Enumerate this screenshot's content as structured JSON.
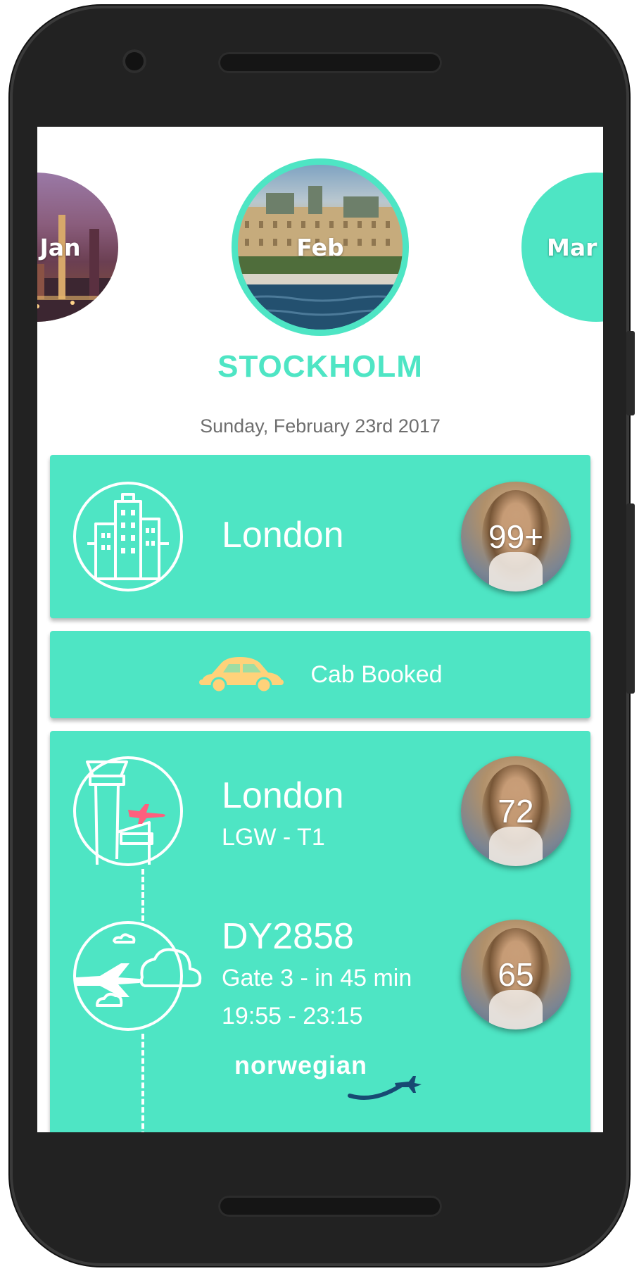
{
  "months": {
    "prev": "Jan",
    "current": "Feb",
    "next": "Mar"
  },
  "destination": {
    "city": "STOCKHOLM",
    "date": "Sunday, February 23rd 2017"
  },
  "cards": {
    "origin": {
      "city": "London",
      "count": "99+"
    },
    "cab": {
      "label": "Cab Booked"
    },
    "airport": {
      "city": "London",
      "terminal": "LGW - T1",
      "count": "72"
    },
    "flight": {
      "number": "DY2858",
      "gate": "Gate 3 - in 45 min",
      "time": "19:55 - 23:15",
      "airline": "norwegian",
      "count": "65"
    }
  },
  "colors": {
    "accent": "#4ee5c4",
    "text_light": "#ffffff",
    "date_text": "#6e6e6e",
    "cab_icon": "#ffd27a",
    "plane_icon": "#ff5f7e"
  }
}
